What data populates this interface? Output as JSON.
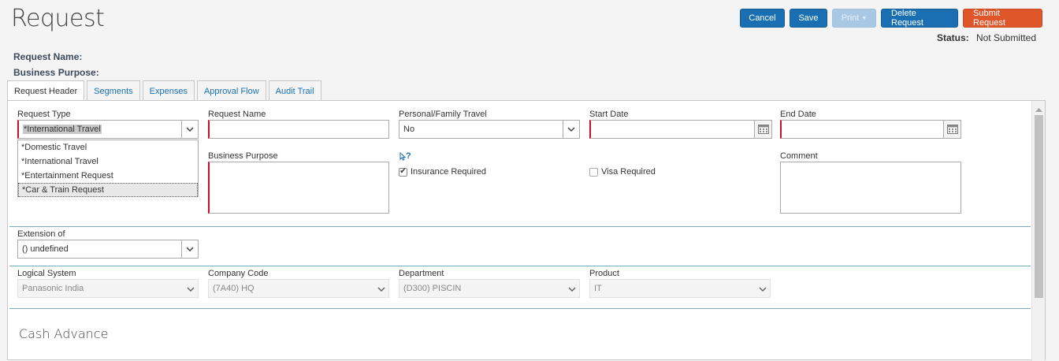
{
  "header": {
    "title": "Request",
    "buttons": {
      "cancel": "Cancel",
      "save": "Save",
      "print": "Print",
      "delete": "Delete Request",
      "submit": "Submit Request"
    },
    "status_label": "Status:",
    "status_value": "Not Submitted"
  },
  "summary": {
    "request_name_label": "Request Name:",
    "business_purpose_label": "Business Purpose:"
  },
  "tabs": [
    {
      "label": "Request Header",
      "active": true
    },
    {
      "label": "Segments"
    },
    {
      "label": "Expenses"
    },
    {
      "label": "Approval Flow"
    },
    {
      "label": "Audit Trail"
    }
  ],
  "form": {
    "request_type": {
      "label": "Request Type",
      "value": "*International Travel",
      "options": [
        "*Domestic Travel",
        "*International Travel",
        "*Entertainment Request",
        "*Car & Train Request"
      ],
      "hovered_option": "*Car & Train Request"
    },
    "request_name": {
      "label": "Request Name",
      "value": ""
    },
    "personal_family_travel": {
      "label": "Personal/Family Travel",
      "value": "No"
    },
    "start_date": {
      "label": "Start Date",
      "value": ""
    },
    "end_date": {
      "label": "End Date",
      "value": ""
    },
    "business_purpose": {
      "label": "Business Purpose",
      "value": ""
    },
    "help_icon_text": "?",
    "insurance_required": {
      "label": "Insurance Required",
      "checked": true
    },
    "visa_required": {
      "label": "Visa Required",
      "checked": false
    },
    "comment": {
      "label": "Comment",
      "value": ""
    },
    "extension_of": {
      "label": "Extension of",
      "value": "() undefined"
    },
    "logical_system": {
      "label": "Logical System",
      "value": "Panasonic India"
    },
    "company_code": {
      "label": "Company Code",
      "value": "(7A40) HQ"
    },
    "department": {
      "label": "Department",
      "value": "(D300) PISCIN"
    },
    "product": {
      "label": "Product",
      "value": "IT"
    }
  },
  "sections": {
    "cash_advance": "Cash Advance"
  },
  "colors": {
    "primary_blue": "#1a6fb3",
    "submit_red": "#e0562b",
    "required_red": "#c8102e",
    "divider": "#7ba7bf"
  }
}
